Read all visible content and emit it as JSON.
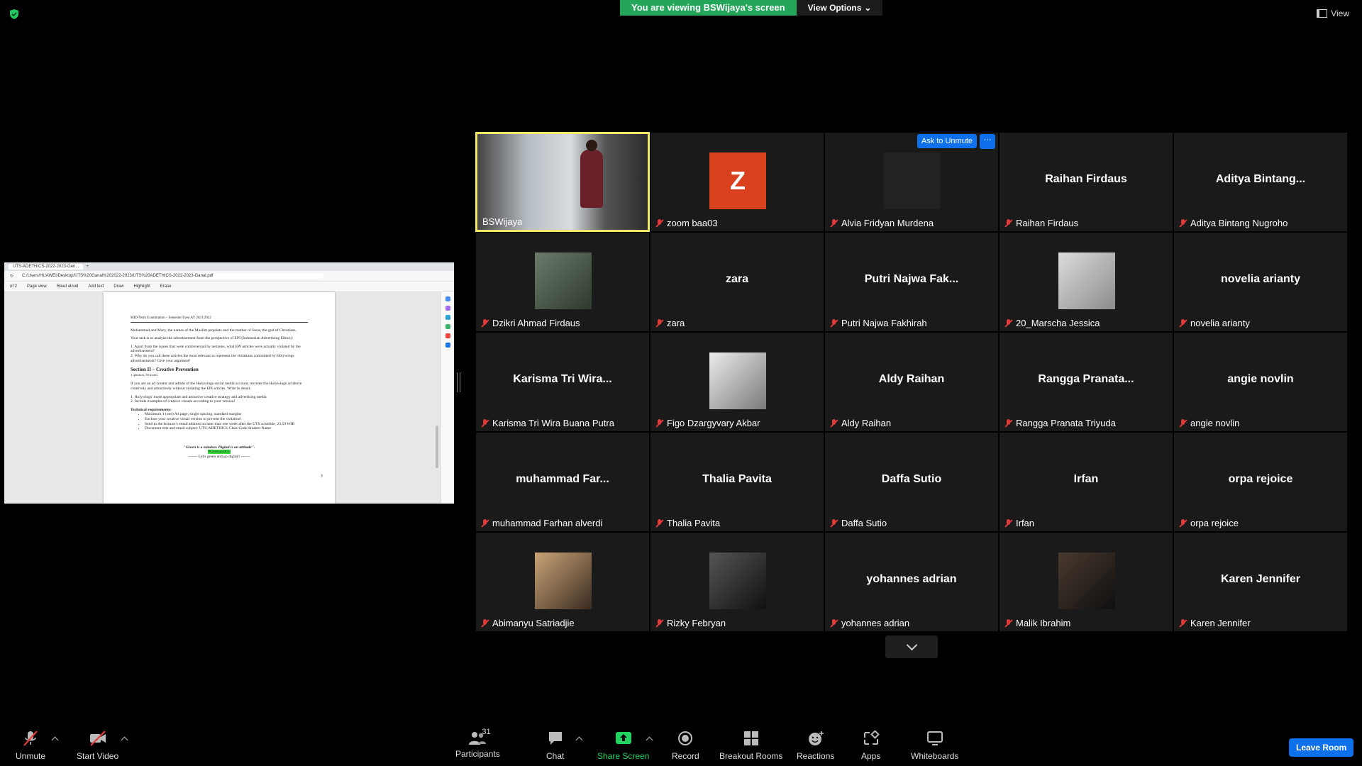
{
  "banner": {
    "viewing": "You are viewing BSWijaya's screen",
    "view_options": "View Options"
  },
  "view_button": "View",
  "shared_screen": {
    "tab_title": "UTS-ADETHICS-2022-2023-Gen...",
    "url": "C:/Users/HUAWEI/Desktop/UTS%20Ganal%202022-2023/UTS%20ADETHICS-2022-2023-Ganal.pdf",
    "page_indicator": "of 2",
    "tools": [
      "Page view",
      "Read aloud",
      "Add text",
      "Draw",
      "Highlight",
      "Erase"
    ],
    "doc": {
      "header": "MID-Term Examination – Semester Even AY 2021/2022",
      "p1": "Muhammad and Mary, the names of the Muslim prophets and the mother of Jesus, the god of Christians.",
      "p2": "Your task is to analyze the advertisement from the perspective of EPI (Indonesian Advertising Ethics):",
      "p3": "1. Apart from the issues that were controversial by netizens, what EPI articles were actually violated by the advertisement?",
      "p4": "2. Why do you call these articles the most relevant to represent the violations committed by Holywings advertisements? Give your argument!",
      "section_title": "Section II – Creative Prevention",
      "section_sub": "1 question, 50 marks",
      "p5": "If you are an ad creator and admin of the Holywings social media account, recreate the Holywings ad above creatively and attractively without violating the EPI articles. Write in detail:",
      "p6": "1. Holywings' more appropriate and attractive creative strategy and advertising media",
      "p7": "2. Include examples of creative visuals according to your version!",
      "tech_title": "Technical requirements:",
      "tech": [
        "Maximum 1 (one) A4 page, single spacing, standard margins",
        "Enclose your creative visual version to prevent the violation!",
        "Send to the lecturer's email address no later than one week after the UTS schedule, 23.59 WIB",
        "Document title and email subject: UTS-ADETHICS-Class Code-Student Name"
      ],
      "quote": "\"Green is a mindset. Digital is an attitude\".",
      "hashtag": "#GreenandGo",
      "closing": "------- Let's green and go digital! -------"
    }
  },
  "participants_grid": [
    {
      "name": "BSWijaya",
      "tile": "video"
    },
    {
      "name": "zoom baa03",
      "tile": "letter",
      "letter": "Z"
    },
    {
      "name": "Alvia Fridyan Murdena",
      "tile": "blank",
      "ask_to_unmute": "Ask to Unmute",
      "more": "···"
    },
    {
      "name": "Raihan Firdaus",
      "tile": "text",
      "display": "Raihan Firdaus"
    },
    {
      "name": "Aditya Bintang Nugroho",
      "tile": "text",
      "display": "Aditya  Bintang..."
    },
    {
      "name": "Dzikri Ahmad Firdaus",
      "tile": "photo"
    },
    {
      "name": "zara",
      "tile": "text",
      "display": "zara"
    },
    {
      "name": "Putri Najwa Fakhirah",
      "tile": "text",
      "display": "Putri Najwa Fak..."
    },
    {
      "name": "20_Marscha Jessica",
      "tile": "photo"
    },
    {
      "name": "novelia arianty",
      "tile": "text",
      "display": "novelia arianty"
    },
    {
      "name": "Karisma Tri Wira Buana Putra",
      "tile": "text",
      "display": "Karisma  Tri Wira..."
    },
    {
      "name": "Figo Dzargyvary Akbar",
      "tile": "photo"
    },
    {
      "name": "Aldy Raihan",
      "tile": "text",
      "display": "Aldy Raihan"
    },
    {
      "name": "Rangga Pranata Triyuda",
      "tile": "text",
      "display": "Rangga  Pranata..."
    },
    {
      "name": "angie novlin",
      "tile": "text",
      "display": "angie novlin"
    },
    {
      "name": "muhammad Farhan alverdi",
      "tile": "text",
      "display": "muhammad  Far..."
    },
    {
      "name": "Thalia Pavita",
      "tile": "text",
      "display": "Thalia Pavita"
    },
    {
      "name": "Daffa Sutio",
      "tile": "text",
      "display": "Daffa Sutio"
    },
    {
      "name": "Irfan",
      "tile": "text",
      "display": "Irfan"
    },
    {
      "name": "orpa rejoice",
      "tile": "text",
      "display": "orpa rejoice"
    },
    {
      "name": "Abimanyu Satriadjie",
      "tile": "photo"
    },
    {
      "name": "Rizky Febryan",
      "tile": "photo"
    },
    {
      "name": "yohannes adrian",
      "tile": "text",
      "display": "yohannes adrian"
    },
    {
      "name": "Malik Ibrahim",
      "tile": "photo"
    },
    {
      "name": "Karen Jennifer",
      "tile": "text",
      "display": "Karen Jennifer"
    }
  ],
  "toolbar": {
    "unmute": "Unmute",
    "start_video": "Start Video",
    "participants": "Participants",
    "participants_count": "31",
    "chat": "Chat",
    "share_screen": "Share Screen",
    "record": "Record",
    "breakout_rooms": "Breakout Rooms",
    "reactions": "Reactions",
    "apps": "Apps",
    "whiteboards": "Whiteboards",
    "leave": "Leave Room"
  },
  "colors": {
    "accent": "#0e71eb",
    "share_green": "#23a55a",
    "speaker_border": "#f2e96b",
    "muted_red": "#e23a3a",
    "avatar_orange": "#d9411e"
  }
}
